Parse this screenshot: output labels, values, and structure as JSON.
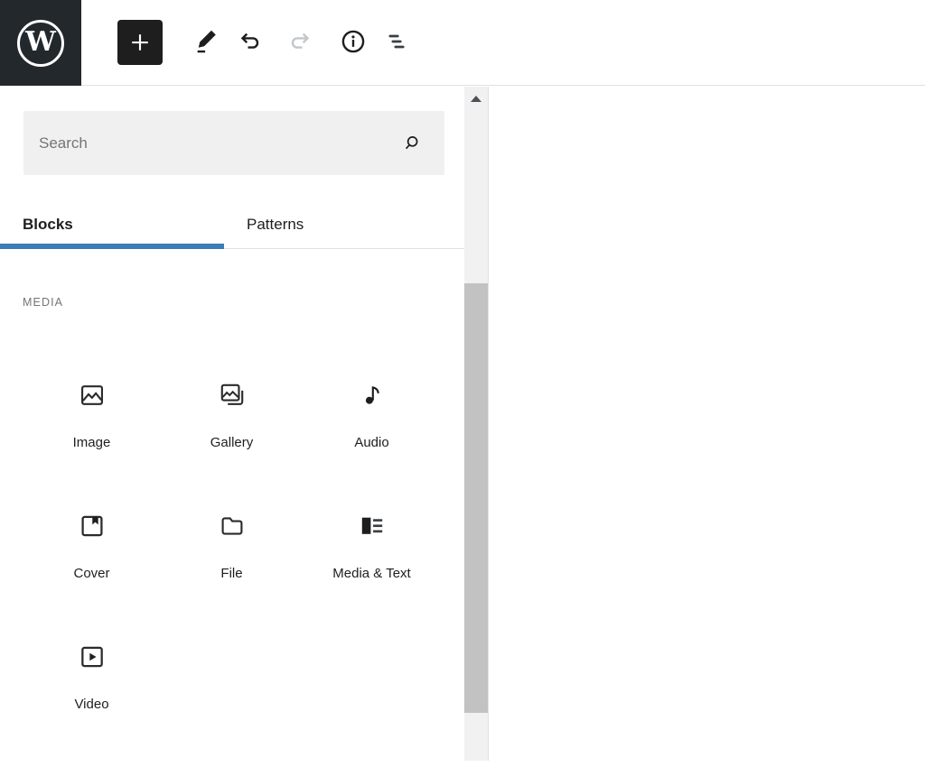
{
  "colors": {
    "accent": "#3c7db6",
    "toolbar_icon": "#1e1e1e",
    "logo_background": "#23282d",
    "disabled_icon": "#c3c6ca",
    "panel_border": "#e0e0e0",
    "search_background": "#f0f0f0",
    "muted_text": "#757575",
    "scrollbar_track": "#f1f1f1",
    "scrollbar_thumb": "#c2c2c2"
  },
  "toolbar": {
    "logo_letter": "W",
    "buttons": [
      {
        "name": "add-block",
        "icon": "plus-icon"
      },
      {
        "name": "tools",
        "icon": "pencil-icon"
      },
      {
        "name": "undo",
        "icon": "undo-arrow-icon",
        "disabled": false
      },
      {
        "name": "redo",
        "icon": "redo-arrow-icon",
        "disabled": true
      },
      {
        "name": "details",
        "icon": "info-icon"
      },
      {
        "name": "list-view",
        "icon": "list-view-icon"
      }
    ]
  },
  "inserter": {
    "search": {
      "placeholder": "Search",
      "value": "",
      "icon": "magnifier-icon"
    },
    "tabs": [
      {
        "label": "Blocks",
        "active": true
      },
      {
        "label": "Patterns",
        "active": false
      }
    ],
    "section": {
      "label": "MEDIA"
    },
    "blocks": [
      {
        "label": "Image",
        "icon": "image-icon"
      },
      {
        "label": "Gallery",
        "icon": "gallery-icon"
      },
      {
        "label": "Audio",
        "icon": "audio-note-icon"
      },
      {
        "label": "Cover",
        "icon": "cover-icon"
      },
      {
        "label": "File",
        "icon": "folder-icon"
      },
      {
        "label": "Media & Text",
        "icon": "media-text-icon"
      },
      {
        "label": "Video",
        "icon": "video-icon"
      }
    ]
  },
  "scrollbar": {
    "orientation": "vertical",
    "up_arrow": true
  }
}
